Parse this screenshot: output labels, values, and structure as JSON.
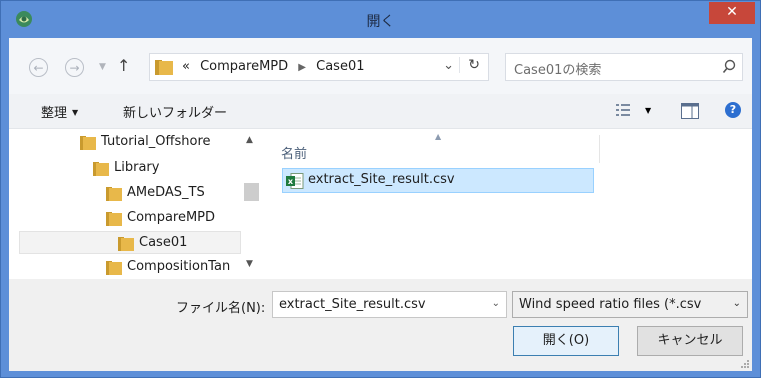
{
  "window": {
    "title": "開く",
    "close_label": "✕"
  },
  "address": {
    "overflow": "«",
    "crumbs": [
      "CompareMPD",
      "Case01"
    ],
    "search_placeholder": "Case01の検索"
  },
  "toolbar": {
    "organize": "整理",
    "new_folder": "新しいフォルダー"
  },
  "tree": {
    "items": [
      {
        "label": "Tutorial_Offshore"
      },
      {
        "label": "Library"
      },
      {
        "label": "AMeDAS_TS"
      },
      {
        "label": "CompareMPD"
      },
      {
        "label": "Case01",
        "selected": true
      },
      {
        "label": "CompositionTan"
      }
    ]
  },
  "list": {
    "column_header": "名前",
    "files": [
      {
        "name": "extract_Site_result.csv",
        "selected": true
      }
    ]
  },
  "bottom": {
    "filename_label": "ファイル名(N):",
    "filename_value": "extract_Site_result.csv",
    "filetype_value": "Wind speed ratio files (*.csv",
    "open_label": "開く(O)",
    "cancel_label": "キャンセル"
  },
  "colors": {
    "titlebar": "#5d8fd8",
    "close": "#c7473a",
    "selection": "#cce8ff",
    "folder": "#e8b84a"
  }
}
